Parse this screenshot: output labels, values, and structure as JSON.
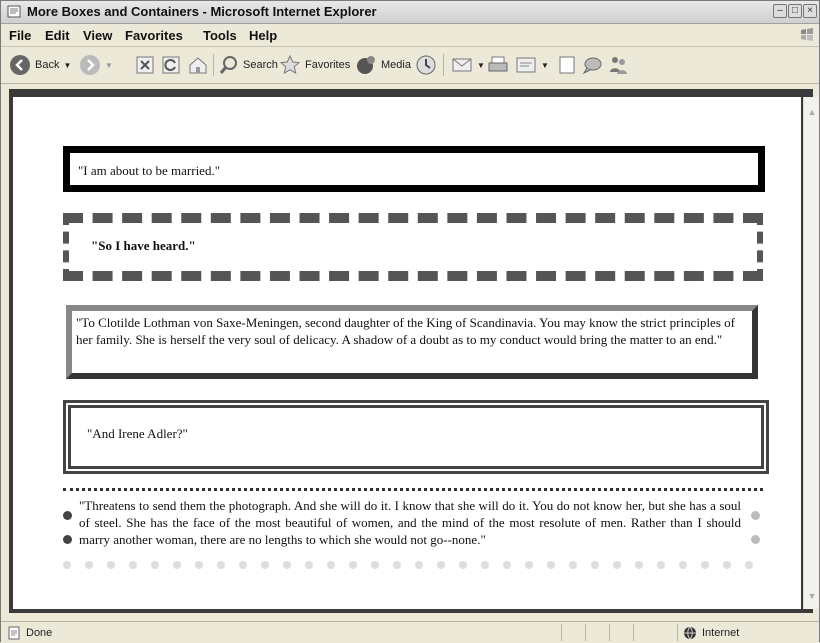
{
  "window": {
    "title": "More Boxes and Containers - Microsoft Internet Explorer"
  },
  "menu": [
    "File",
    "Edit",
    "View",
    "Favorites",
    "Tools",
    "Help"
  ],
  "toolbar": {
    "back_label": "Back",
    "search_label": "Search",
    "favorites_label": "Favorites",
    "media_label": "Media"
  },
  "page": {
    "quote1": "\"I am about to be married.\"",
    "quote2": "\"So I have heard.\"",
    "quote3": "\"To Clotilde Lothman von Saxe-Meningen, second daughter of the King of Scandinavia. You may know the strict principles of her family. She is herself the very soul of delicacy. A shadow of a doubt as to my conduct would bring the matter to an end.\"",
    "quote4": "\"And Irene Adler?\"",
    "quote5": "\"Threatens to send them the photograph. And she will do it. I know that she will do it. You do not know her, but she has a soul of steel. She has the face of the most beautiful of women, and the mind of the most resolute of men. Rather than I should marry another woman, there are no lengths to which she would not go--none.\""
  },
  "status": {
    "left_text": "Done",
    "zone_text": "Internet"
  }
}
